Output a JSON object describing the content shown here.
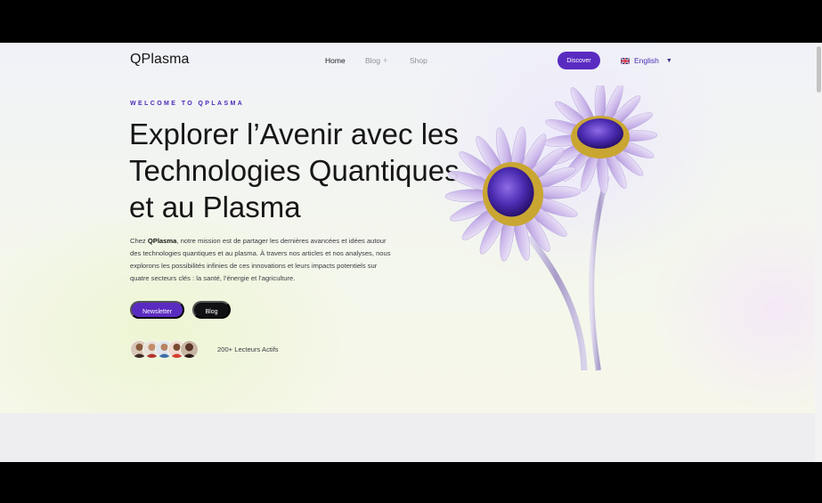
{
  "brand": {
    "name": "QPlasma"
  },
  "nav": {
    "home": "Home",
    "blog": "Blog",
    "blog_expand": "+",
    "shop": "Shop"
  },
  "header": {
    "discover_label": "Discover",
    "language": "English",
    "language_flag": "uk-flag-icon"
  },
  "hero": {
    "kicker": "WELCOME TO QPLASMA",
    "headline": [
      "Explorer l’Avenir avec les",
      "Technologies Quantiques",
      "et au Plasma"
    ],
    "desc_prefix": "Chez ",
    "desc_brand": "QPlasma",
    "desc_body": ", notre mission est de partager les dernières avancées et idées autour des technologies quantiques et au plasma. À travers nos articles et nos analyses, nous explorons les possibilités infinies de ces innovations et leurs impacts potentiels sur quatre secteurs clés : la santé, l’énergie et l’agriculture.",
    "newsletter_label": "Newsletter",
    "blog_label": "Blog",
    "readers_text": "200+ Lecteurs Actifs"
  },
  "colors": {
    "accent": "#5a2bc1",
    "dark": "#111114"
  }
}
